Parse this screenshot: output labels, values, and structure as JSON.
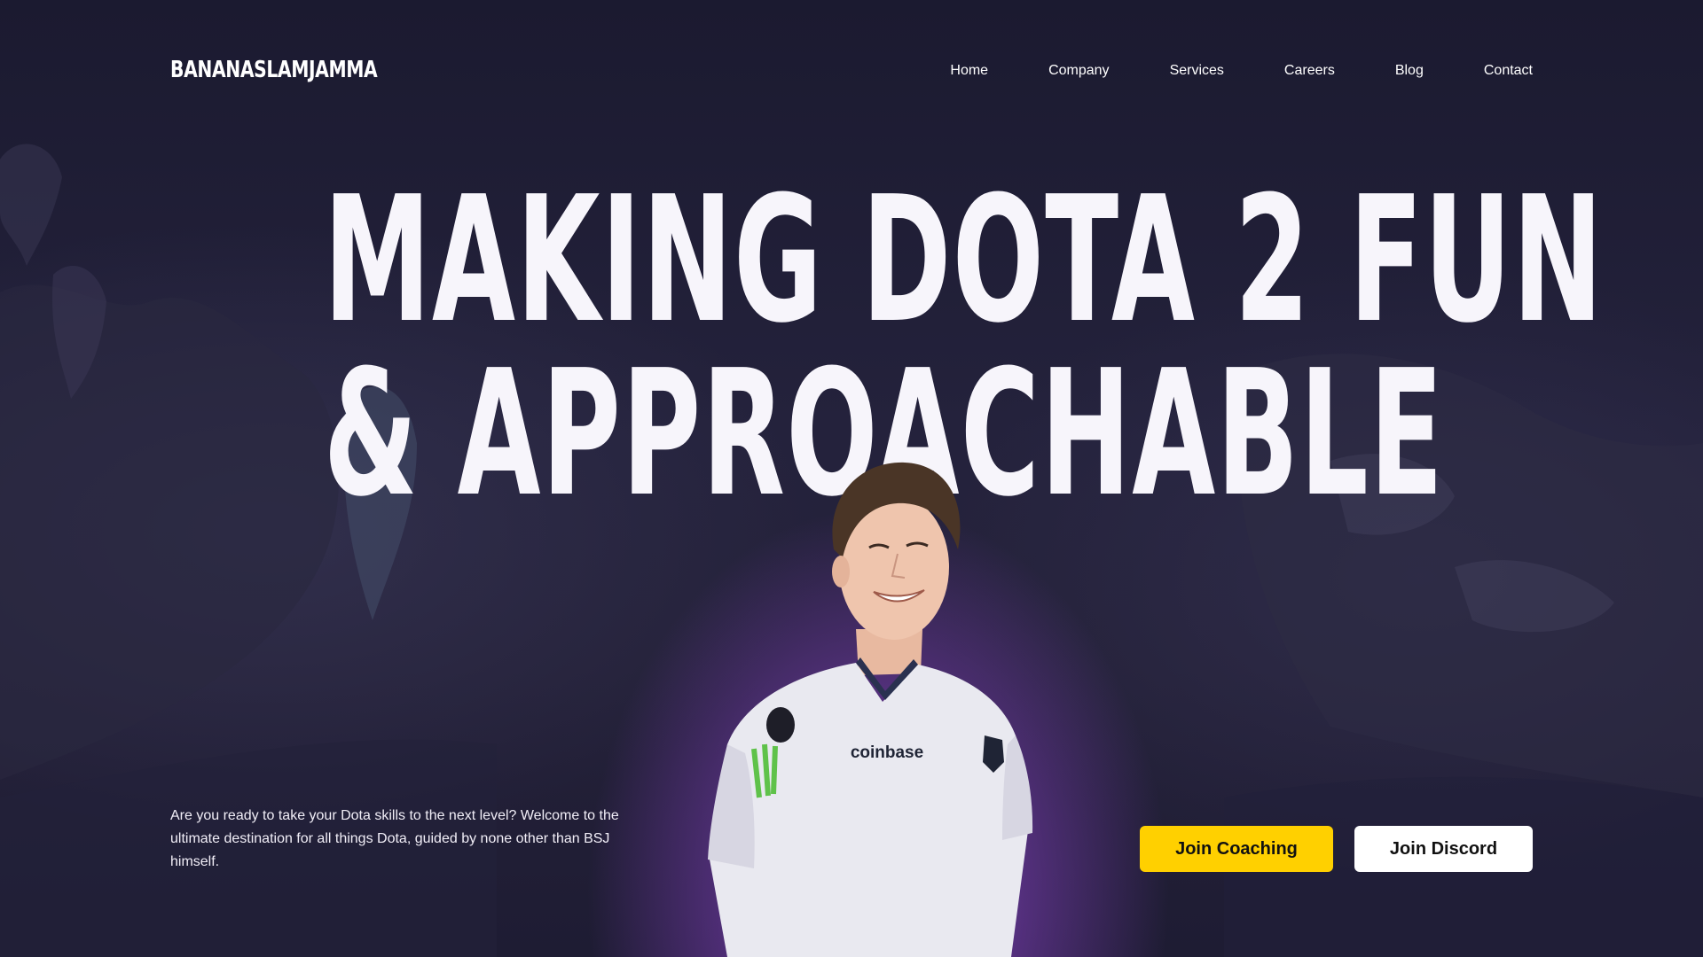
{
  "brand": {
    "logo_text": "BANANASLAMJAMMA"
  },
  "nav": {
    "items": [
      {
        "label": "Home"
      },
      {
        "label": "Company"
      },
      {
        "label": "Services"
      },
      {
        "label": "Careers"
      },
      {
        "label": "Blog"
      },
      {
        "label": "Contact"
      }
    ]
  },
  "hero": {
    "headline_line1": "MAKING DOTA 2 FUN",
    "headline_line2": "& APPROACHABLE",
    "intro": "Are you ready to take your Dota skills to the next level? Welcome to the ultimate destination for all things Dota, guided by none other than BSJ himself.",
    "jersey_sponsor": "coinbase"
  },
  "actions": {
    "coaching_label": "Join Coaching",
    "discord_label": "Join Discord"
  },
  "colors": {
    "background": "#1d1c33",
    "accent_yellow": "#ffd000",
    "glow_purple": "#a050d2",
    "text": "#ffffff"
  }
}
